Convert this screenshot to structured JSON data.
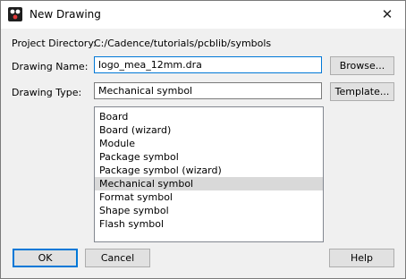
{
  "window": {
    "title": "New Drawing"
  },
  "form": {
    "project_directory_label": "Project Directory:",
    "project_directory_value": "C:/Cadence/tutorials/pcblib/symbols",
    "drawing_name_label": "Drawing Name:",
    "drawing_name_value": "logo_mea_12mm.dra",
    "drawing_type_label": "Drawing Type:",
    "drawing_type_value": "Mechanical symbol",
    "browse_label": "Browse...",
    "template_label": "Template..."
  },
  "type_list": {
    "items": [
      "Board",
      "Board (wizard)",
      "Module",
      "Package symbol",
      "Package symbol (wizard)",
      "Mechanical symbol",
      "Format symbol",
      "Shape symbol",
      "Flash symbol"
    ],
    "selected": "Mechanical symbol"
  },
  "footer": {
    "ok_label": "OK",
    "cancel_label": "Cancel",
    "help_label": "Help"
  },
  "icons": {
    "app": "cadence-app-icon",
    "close": "close-icon"
  },
  "colors": {
    "accent": "#0078d7",
    "selection": "#d9d9d9"
  }
}
